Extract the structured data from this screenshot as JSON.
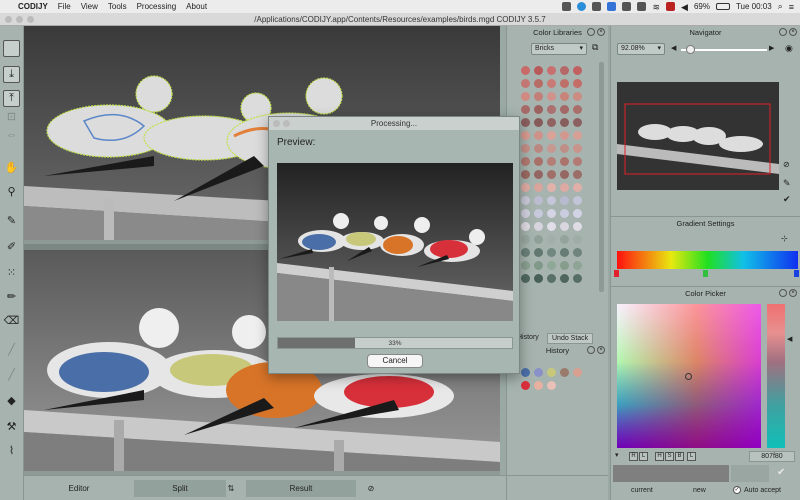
{
  "menubar": {
    "app_name": "CODIJY",
    "items": [
      "File",
      "View",
      "Tools",
      "Processing",
      "About"
    ],
    "battery": "69%",
    "clock": "Tue 00:03"
  },
  "window": {
    "title": "/Applications/CODIJY.app/Contents/Resources/examples/birds.mgd CODIJY 3.5.7"
  },
  "bottom_bar": {
    "editor_label": "Editor",
    "split_label": "Split",
    "result_label": "Result"
  },
  "color_libraries": {
    "title": "Color Libraries",
    "selected_library": "Bricks"
  },
  "navigator": {
    "title": "Navigator",
    "zoom": "92.08%"
  },
  "gradient_settings": {
    "title": "Gradient Settings"
  },
  "history": {
    "tab_history": "History",
    "tab_undo_stack": "Undo Stack",
    "title": "History"
  },
  "color_picker": {
    "title": "Color Picker",
    "channel_buttons": [
      "R",
      "L",
      "H",
      "S",
      "B",
      "L"
    ],
    "hex_value": "807f80",
    "current_label": "current",
    "new_label": "new",
    "auto_accept_label": "Auto accept"
  },
  "dialog": {
    "title": "Processing...",
    "preview_label": "Preview:",
    "progress_value": 33,
    "progress_text": "33%",
    "cancel_label": "Cancel"
  },
  "colors": {
    "accent_red": "#e0202a",
    "bird_blue": "#4a6fa8",
    "bird_yellow": "#c8c87a",
    "bird_orange": "#d87428",
    "bird_red": "#d8303a"
  }
}
